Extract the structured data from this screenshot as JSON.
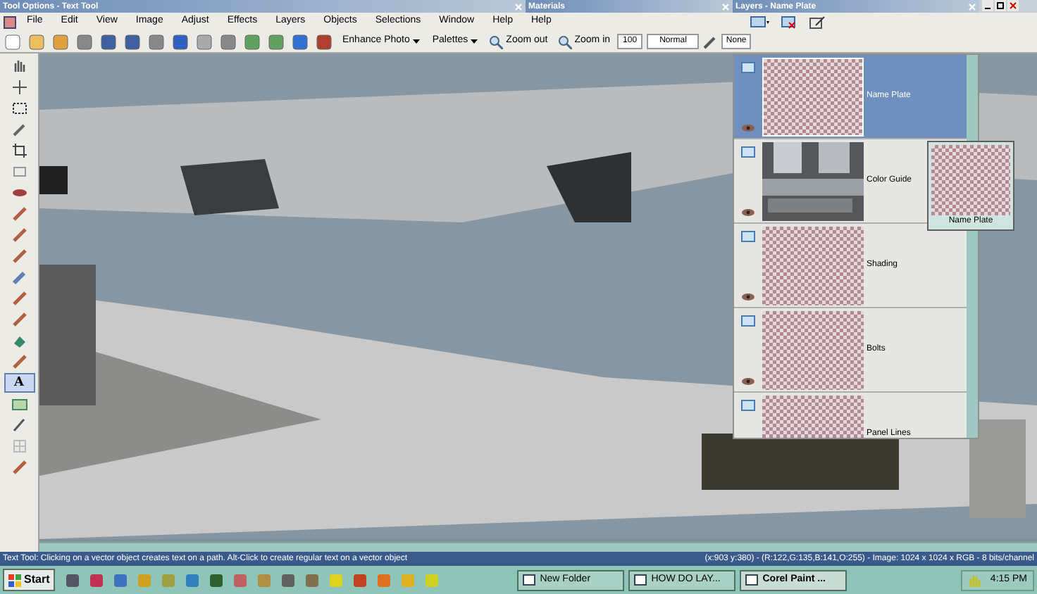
{
  "title_bars": [
    {
      "title": "Tool Options - Text Tool"
    },
    {
      "title": "Materials"
    },
    {
      "title": "Layers - Name Plate"
    }
  ],
  "menu": [
    "File",
    "Edit",
    "View",
    "Image",
    "Adjust",
    "Effects",
    "Layers",
    "Objects",
    "Selections",
    "Window",
    "Help",
    "Help"
  ],
  "toolbar": {
    "enhance": "Enhance Photo",
    "palettes": "Palettes",
    "zoom_out": "Zoom out",
    "zoom_in": "Zoom in",
    "opacity": "100",
    "blend_mode": "Normal",
    "mask": "None"
  },
  "tools": [
    {
      "kind": "pan",
      "selected": false
    },
    {
      "kind": "move",
      "selected": false
    },
    {
      "kind": "select",
      "selected": false
    },
    {
      "kind": "dropper",
      "selected": false
    },
    {
      "kind": "crop",
      "selected": false
    },
    {
      "kind": "deform",
      "selected": false
    },
    {
      "kind": "eye",
      "selected": false
    },
    {
      "kind": "brush",
      "selected": false
    },
    {
      "kind": "brush",
      "selected": false
    },
    {
      "kind": "brush",
      "selected": false
    },
    {
      "kind": "retouch",
      "selected": false
    },
    {
      "kind": "brush",
      "selected": false
    },
    {
      "kind": "brush",
      "selected": false
    },
    {
      "kind": "fill",
      "selected": false
    },
    {
      "kind": "brush",
      "selected": false
    },
    {
      "kind": "text",
      "label": "A",
      "selected": true
    },
    {
      "kind": "shape",
      "selected": false
    },
    {
      "kind": "pen",
      "selected": false
    },
    {
      "kind": "grid",
      "selected": false
    },
    {
      "kind": "brush",
      "selected": false
    }
  ],
  "layers": [
    {
      "name": "Name Plate",
      "kind": "transparent",
      "selected": true
    },
    {
      "name": "Color Guide",
      "kind": "image",
      "selected": false
    },
    {
      "name": "Shading",
      "kind": "transparent",
      "selected": false
    },
    {
      "name": "Bolts",
      "kind": "transparent",
      "selected": false
    },
    {
      "name": "Panel Lines",
      "kind": "transparent",
      "selected": false
    }
  ],
  "tooltip": {
    "label": "Name Plate"
  },
  "status_bar": {
    "hint": "Text Tool: Clicking on a vector object creates text on a path. Alt-Click to create regular text on a vector object",
    "info": "(x:903 y:380) - (R:122,G:135,B:141,O:255) - Image: 1024 x 1024 x RGB - 8 bits/channel"
  },
  "taskbar": {
    "start": "Start",
    "windows": [
      {
        "label": "New Folder",
        "selected": false
      },
      {
        "label": "HOW DO LAY...",
        "selected": false
      },
      {
        "label": "Corel Paint ...",
        "selected": true
      }
    ],
    "clock": "4:15 PM"
  }
}
